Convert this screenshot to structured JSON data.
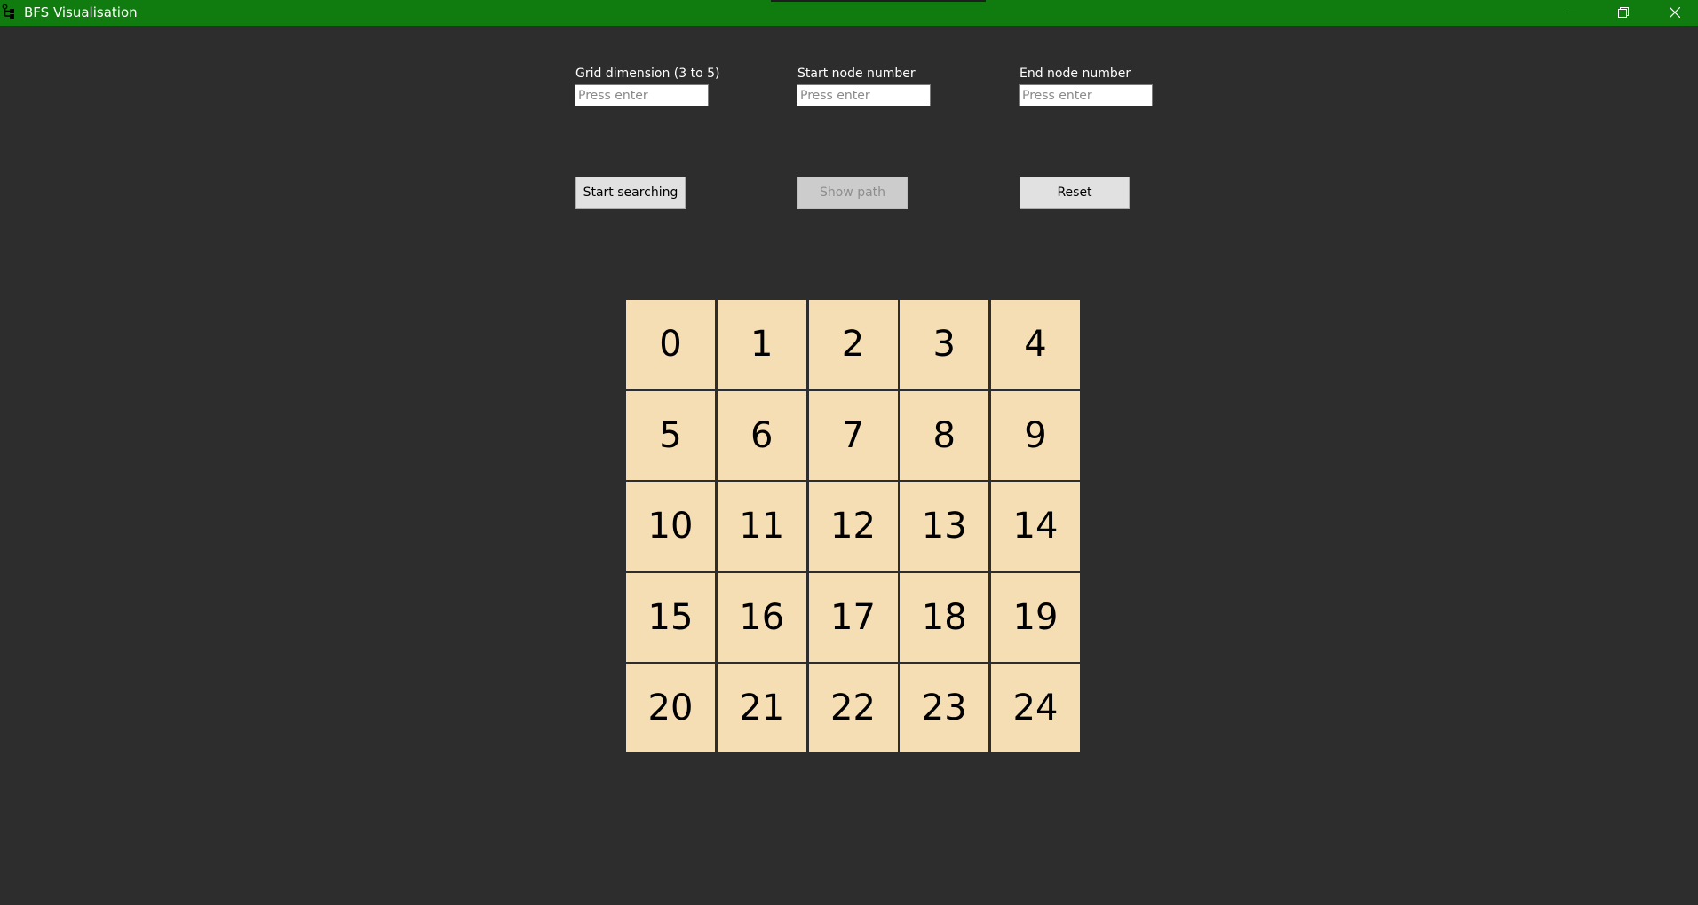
{
  "window": {
    "title": "BFS Visualisation",
    "titlebar_color": "#107c10",
    "icons": [
      "app-icon",
      "minimize-icon",
      "maximize-icon",
      "close-icon"
    ]
  },
  "inputs": {
    "grid_dimension": {
      "label": "Grid dimension (3 to 5)",
      "placeholder": "Press enter",
      "value": ""
    },
    "start_node": {
      "label": "Start node number",
      "placeholder": "Press enter",
      "value": ""
    },
    "end_node": {
      "label": "End node number",
      "placeholder": "Press enter",
      "value": ""
    }
  },
  "buttons": {
    "start_searching": {
      "label": "Start searching",
      "enabled": true
    },
    "show_path": {
      "label": "Show path",
      "enabled": false
    },
    "reset": {
      "label": "Reset",
      "enabled": true
    }
  },
  "grid": {
    "dimension": 5,
    "cell_color": "#f5deb3",
    "cells": [
      "0",
      "1",
      "2",
      "3",
      "4",
      "5",
      "6",
      "7",
      "8",
      "9",
      "10",
      "11",
      "12",
      "13",
      "14",
      "15",
      "16",
      "17",
      "18",
      "19",
      "20",
      "21",
      "22",
      "23",
      "24"
    ]
  }
}
